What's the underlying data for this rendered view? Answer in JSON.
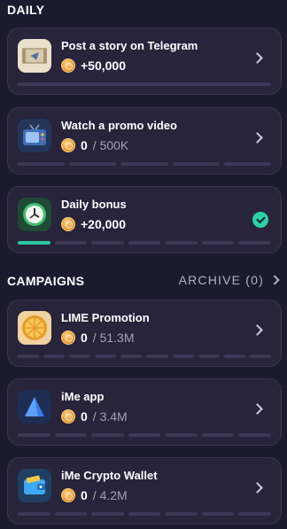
{
  "sections": {
    "daily": "DAILY",
    "campaigns": "CAMPAIGNS",
    "archive": "ARCHIVE (0)"
  },
  "colors": {
    "background": "#1c1a2e",
    "card": "#27243b",
    "accent": "#2bc9a2"
  },
  "daily": [
    {
      "title": "Post a story on Telegram",
      "amount": "+50,000",
      "total": "",
      "icon": "scroll-telegram-icon",
      "progress_segments": 1,
      "filled": 0
    },
    {
      "title": "Watch a promo video",
      "amount": "0",
      "total": "/ 500K",
      "icon": "tv-icon",
      "progress_segments": 5,
      "filled": 0
    },
    {
      "title": "Daily bonus",
      "amount": "+20,000",
      "total": "",
      "icon": "clock-icon",
      "progress_segments": 7,
      "filled": 1,
      "completed": true
    }
  ],
  "campaigns": [
    {
      "title": "LIME Promotion",
      "amount": "0",
      "total": "/ 51.3M",
      "icon": "lime-icon",
      "progress_segments": 10,
      "filled": 0
    },
    {
      "title": "iMe app",
      "amount": "0",
      "total": "/ 3.4M",
      "icon": "ime-triangle-icon",
      "progress_segments": 7,
      "filled": 0
    },
    {
      "title": "iMe Crypto Wallet",
      "amount": "0",
      "total": "/ 4.2M",
      "icon": "wallet-icon",
      "progress_segments": 7,
      "filled": 0
    }
  ]
}
